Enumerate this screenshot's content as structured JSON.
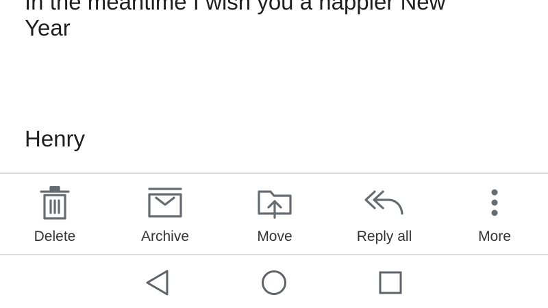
{
  "message": {
    "body": "In the meantime I wish you a happier New\nYear",
    "signature": "Henry"
  },
  "toolbar": {
    "actions": [
      {
        "label": "Delete",
        "icon": "trash-icon"
      },
      {
        "label": "Archive",
        "icon": "archive-icon"
      },
      {
        "label": "Move",
        "icon": "move-to-folder-icon"
      },
      {
        "label": "Reply all",
        "icon": "reply-all-icon"
      },
      {
        "label": "More",
        "icon": "more-vertical-icon"
      }
    ],
    "icon_color": "#666b70"
  },
  "navbar": {
    "buttons": [
      "back-icon",
      "home-icon",
      "recents-icon"
    ],
    "icon_color": "#5f6368"
  }
}
